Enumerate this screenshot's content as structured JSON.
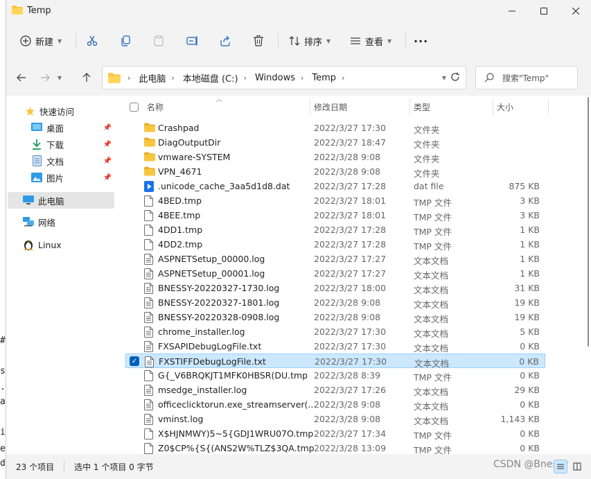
{
  "window": {
    "title": "Temp"
  },
  "toolbar": {
    "new_label": "新建",
    "sort_label": "排序",
    "view_label": "查看",
    "more_label": "···"
  },
  "breadcrumb": [
    "此电脑",
    "本地磁盘 (C:)",
    "Windows",
    "Temp"
  ],
  "search": {
    "placeholder": "搜索\"Temp\""
  },
  "nav": {
    "quick_access": "快速访问",
    "desktop": "桌面",
    "downloads": "下载",
    "documents": "文档",
    "pictures": "图片",
    "this_pc": "此电脑",
    "network": "网络",
    "linux": "Linux"
  },
  "columns": {
    "name": "名称",
    "date": "修改日期",
    "type": "类型",
    "size": "大小"
  },
  "files": [
    {
      "name": "Crashpad",
      "date": "2022/3/27 17:30",
      "type": "文件夹",
      "size": "",
      "icon": "folder-icon"
    },
    {
      "name": "DiagOutputDir",
      "date": "2022/3/27 18:47",
      "type": "文件夹",
      "size": "",
      "icon": "folder-icon"
    },
    {
      "name": "vmware-SYSTEM",
      "date": "2022/3/28 9:08",
      "type": "文件夹",
      "size": "",
      "icon": "folder-icon"
    },
    {
      "name": "VPN_4671",
      "date": "2022/3/28 9:08",
      "type": "文件夹",
      "size": "",
      "icon": "folder-icon"
    },
    {
      "name": ".unicode_cache_3aa5d1d8.dat",
      "date": "2022/3/27 17:28",
      "type": "dat file",
      "size": "875 KB",
      "icon": "media-file-icon"
    },
    {
      "name": "4BED.tmp",
      "date": "2022/3/27 18:01",
      "type": "TMP 文件",
      "size": "3 KB",
      "icon": "file-icon"
    },
    {
      "name": "4BEE.tmp",
      "date": "2022/3/27 18:01",
      "type": "TMP 文件",
      "size": "3 KB",
      "icon": "file-icon"
    },
    {
      "name": "4DD1.tmp",
      "date": "2022/3/27 17:28",
      "type": "TMP 文件",
      "size": "1 KB",
      "icon": "file-icon"
    },
    {
      "name": "4DD2.tmp",
      "date": "2022/3/27 17:28",
      "type": "TMP 文件",
      "size": "1 KB",
      "icon": "file-icon"
    },
    {
      "name": "ASPNETSetup_00000.log",
      "date": "2022/3/27 17:27",
      "type": "文本文档",
      "size": "1 KB",
      "icon": "text-file-icon"
    },
    {
      "name": "ASPNETSetup_00001.log",
      "date": "2022/3/27 17:27",
      "type": "文本文档",
      "size": "1 KB",
      "icon": "text-file-icon"
    },
    {
      "name": "BNESSY-20220327-1730.log",
      "date": "2022/3/27 18:00",
      "type": "文本文档",
      "size": "31 KB",
      "icon": "text-file-icon"
    },
    {
      "name": "BNESSY-20220327-1801.log",
      "date": "2022/3/28 9:08",
      "type": "文本文档",
      "size": "19 KB",
      "icon": "text-file-icon"
    },
    {
      "name": "BNESSY-20220328-0908.log",
      "date": "2022/3/28 9:08",
      "type": "文本文档",
      "size": "19 KB",
      "icon": "text-file-icon"
    },
    {
      "name": "chrome_installer.log",
      "date": "2022/3/27 17:30",
      "type": "文本文档",
      "size": "5 KB",
      "icon": "text-file-icon"
    },
    {
      "name": "FXSAPIDebugLogFile.txt",
      "date": "2022/3/27 17:30",
      "type": "文本文档",
      "size": "0 KB",
      "icon": "text-file-icon"
    },
    {
      "name": "FXSTIFFDebugLogFile.txt",
      "date": "2022/3/27 17:30",
      "type": "文本文档",
      "size": "0 KB",
      "icon": "text-file-icon",
      "selected": true
    },
    {
      "name": "G{_V6BRQKJT1MFK0HBSR(DU.tmp",
      "date": "2022/3/28 8:39",
      "type": "TMP 文件",
      "size": "0 KB",
      "icon": "file-icon"
    },
    {
      "name": "msedge_installer.log",
      "date": "2022/3/27 17:26",
      "type": "文本文档",
      "size": "29 KB",
      "icon": "text-file-icon"
    },
    {
      "name": "officeclicktorun.exe_streamserver(...",
      "date": "2022/3/28 9:08",
      "type": "文本文档",
      "size": "0 KB",
      "icon": "text-file-icon"
    },
    {
      "name": "vminst.log",
      "date": "2022/3/28 9:08",
      "type": "文本文档",
      "size": "1,143 KB",
      "icon": "text-file-icon"
    },
    {
      "name": "X$HJNMWY)5~5{GDJ1WRU07O.tmp",
      "date": "2022/3/27 17:34",
      "type": "TMP 文件",
      "size": "0 KB",
      "icon": "file-icon"
    },
    {
      "name": "Z0$CP%{S{(ANS2W%TLZ$3QA.tmp",
      "date": "2022/3/28 13:09",
      "type": "TMP 文件",
      "size": "0 KB",
      "icon": "file-icon"
    }
  ],
  "status": {
    "item_count": "23 个项目",
    "selection": "选中 1 个项目 0 字节"
  },
  "watermark": "CSDN @Bnessy",
  "colors": {
    "accent": "#005fb8",
    "selection_bg": "#cce8ff",
    "folder": "#f8c640"
  },
  "bg_chars": [
    "#",
    "s",
    ".",
    "a",
    "i",
    "e",
    "d"
  ]
}
